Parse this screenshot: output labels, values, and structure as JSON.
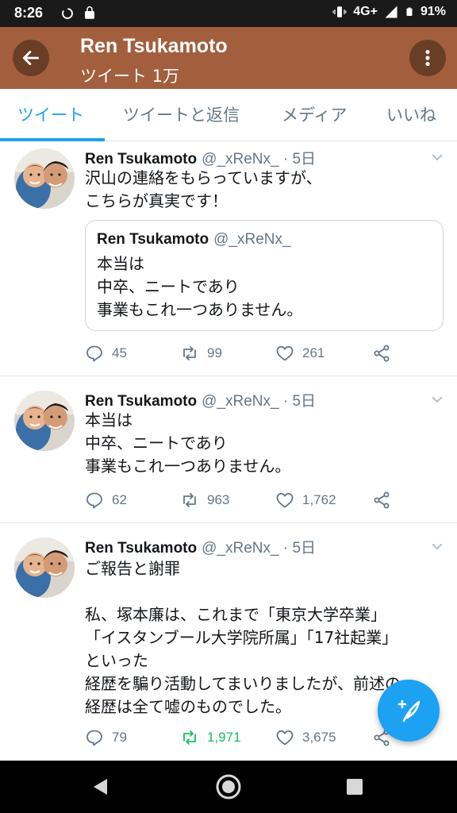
{
  "status_bar": {
    "time": "8:26",
    "network": "4G+",
    "battery": "91%",
    "icons": [
      "data-saver-icon",
      "shopping-bag-icon",
      "vibrate-icon",
      "signal-icon",
      "battery-icon"
    ]
  },
  "header": {
    "title": "Ren Tsukamoto",
    "subtitle": "ツイート 1万",
    "bg_color": "#a35f3d"
  },
  "tabs": [
    {
      "label": "ツイート",
      "active": true
    },
    {
      "label": "ツイートと返信",
      "active": false
    },
    {
      "label": "メディア",
      "active": false
    },
    {
      "label": "いいね",
      "active": false
    }
  ],
  "accent_color": "#1da1f2",
  "retweet_active_color": "#17bf63",
  "tweets": [
    {
      "name": "Ren Tsukamoto",
      "meta": "@_xReNx_ · 5日",
      "text": "沢山の連絡をもらっていますが、\nこちらが真実です！",
      "quote": {
        "name": "Ren Tsukamoto",
        "handle": "@_xReNx_",
        "text": "本当は\n中卒、ニートであり\n事業もこれ一つありません。"
      },
      "replies": "45",
      "retweets": "99",
      "likes": "261"
    },
    {
      "name": "Ren Tsukamoto",
      "meta": "@_xReNx_ · 5日",
      "text": "本当は\n中卒、ニートであり\n事業もこれ一つありません。",
      "replies": "62",
      "retweets": "963",
      "likes": "1,762"
    },
    {
      "name": "Ren Tsukamoto",
      "meta": "@_xReNx_ · 5日",
      "text": "ご報告と謝罪\n\n私、塚本廉は、これまで「東京大学卒業」\n「イスタンブール大学院所属」「17社起業」\nといった\n経歴を騙り活動してまいりましたが、前述の\n経歴は全て嘘のものでした。",
      "replies": "79",
      "retweets": "1,971",
      "likes": "3,675",
      "retweeted": true
    }
  ]
}
